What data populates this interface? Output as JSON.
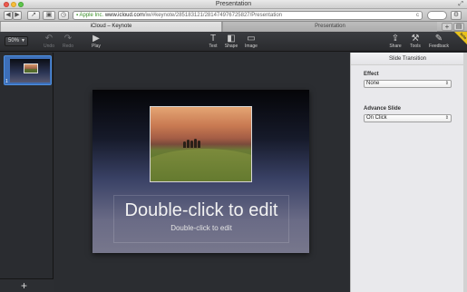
{
  "window": {
    "title": "Presentation"
  },
  "browser": {
    "back_icon": "back-arrow-icon",
    "forward_icon": "forward-arrow-icon",
    "address_secure_label": "Apple Inc.",
    "address_host": "www.icloud.com",
    "address_path": "/iw/#keynote/285183121/281474976725827/Presentation",
    "reload_glyph": "c",
    "tabs": [
      {
        "label": "iCloud – Keynote",
        "active": true
      },
      {
        "label": "Presentation",
        "active": false
      }
    ],
    "new_tab_glyph": "+"
  },
  "keynote_toolbar": {
    "zoom_value": "50%",
    "undo_label": "Undo",
    "redo_label": "Redo",
    "play_label": "Play",
    "text_label": "Text",
    "shape_label": "Shape",
    "image_label": "Image",
    "share_label": "Share",
    "tools_label": "Tools",
    "feedback_label": "Feedback",
    "beta_label": "beta"
  },
  "navigator": {
    "slides": [
      {
        "number": "1",
        "selected": true
      }
    ],
    "add_glyph": "+"
  },
  "slide": {
    "title": "Double-click to edit",
    "subtitle": "Double-click to edit"
  },
  "inspector": {
    "header": "Slide Transition",
    "effect_label": "Effect",
    "effect_value": "None",
    "advance_label": "Advance Slide",
    "advance_value": "On Click"
  },
  "colors": {
    "inspector_bg": "#e9e9ec",
    "toolbar_bg": "#2f3034",
    "selection": "#4d8fe0",
    "beta_ribbon": "#e8c21c"
  }
}
